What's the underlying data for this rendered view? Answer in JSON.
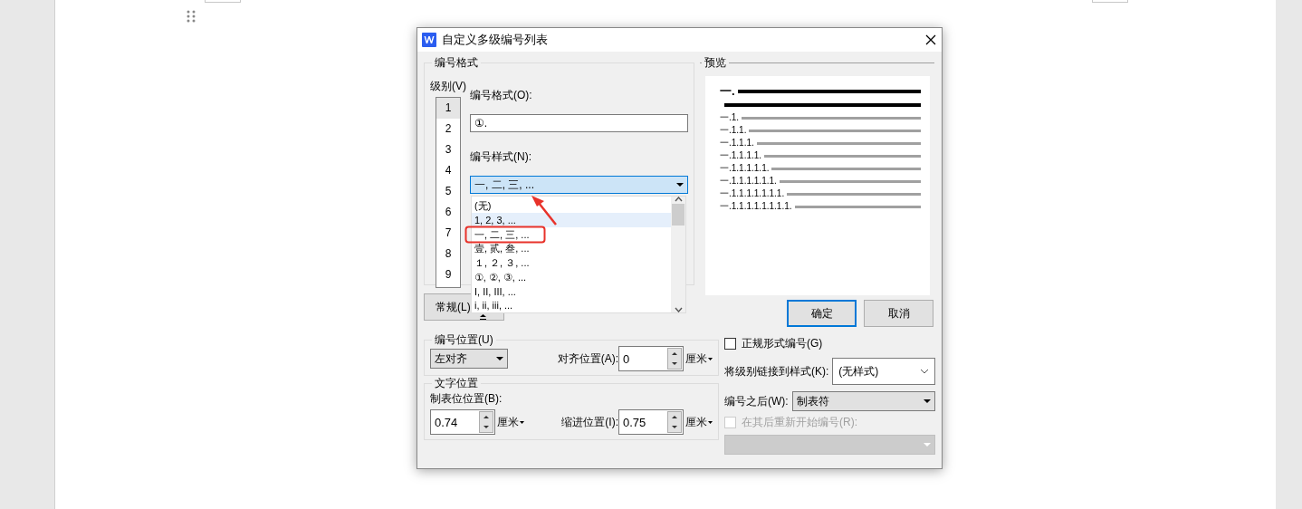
{
  "dialog": {
    "title": "自定义多级编号列表"
  },
  "number_format": {
    "legend": "编号格式",
    "level_label": "级别(V)",
    "levels": [
      {
        "label": "1",
        "selected": true
      },
      {
        "label": "2",
        "selected": false
      },
      {
        "label": "3",
        "selected": false
      },
      {
        "label": "4",
        "selected": false
      },
      {
        "label": "5",
        "selected": false
      },
      {
        "label": "6",
        "selected": false
      },
      {
        "label": "7",
        "selected": false
      },
      {
        "label": "8",
        "selected": false
      },
      {
        "label": "9",
        "selected": false
      }
    ],
    "format_label": "编号格式(O):",
    "format_value": "①.",
    "style_label": "编号样式(N):",
    "style_value": "一, 二, 三, ...",
    "style_options": [
      {
        "label": "(无)",
        "selected": false
      },
      {
        "label": "1, 2, 3, ...",
        "selected": true
      },
      {
        "label": "一, 二, 三, ...",
        "selected": false
      },
      {
        "label": "壹, 贰, 叁, ...",
        "selected": false
      },
      {
        "label": "１, ２, ３, ...",
        "selected": false
      },
      {
        "label": "①, ②, ③, ...",
        "selected": false
      },
      {
        "label": "I, II, III, ...",
        "selected": false
      },
      {
        "label": "i, ii, iii, ...",
        "selected": false
      }
    ]
  },
  "more_button": {
    "label": "常规(L)"
  },
  "preview": {
    "legend": "预览",
    "lines": [
      {
        "kind": "heading",
        "label": "一."
      },
      {
        "kind": "rule"
      },
      {
        "kind": "level",
        "label": "一.1."
      },
      {
        "kind": "level",
        "label": "一.1.1."
      },
      {
        "kind": "level",
        "label": "一.1.1.1."
      },
      {
        "kind": "level",
        "label": "一.1.1.1.1."
      },
      {
        "kind": "level",
        "label": "一.1.1.1.1.1."
      },
      {
        "kind": "level",
        "label": "一.1.1.1.1.1.1."
      },
      {
        "kind": "level",
        "label": "一.1.1.1.1.1.1.1."
      },
      {
        "kind": "level",
        "label": "一.1.1.1.1.1.1.1.1."
      }
    ]
  },
  "buttons": [
    {
      "label": "确定",
      "default": true
    },
    {
      "label": "取消",
      "default": false
    }
  ],
  "legal_numbering": {
    "label": "正规形式编号(G)",
    "checked": false
  },
  "link_style": {
    "label": "将级别链接到样式(K):",
    "value": "(无样式)"
  },
  "follow_number": {
    "label": "编号之后(W):",
    "value": "制表符"
  },
  "restart": {
    "label": "在其后重新开始编号(R):",
    "checked": false,
    "disabled": true
  },
  "number_position": {
    "legend": "编号位置(U)",
    "alignment": "左对齐",
    "align_at_label": "对齐位置(A):",
    "align_at_value": "0",
    "unit": "厘米"
  },
  "text_position": {
    "legend": "文字位置",
    "tab_label": "制表位位置(B):",
    "tab_value": "0.74",
    "tab_unit": "厘米",
    "indent_label": "缩进位置(I):",
    "indent_value": "0.75",
    "indent_unit": "厘米"
  }
}
